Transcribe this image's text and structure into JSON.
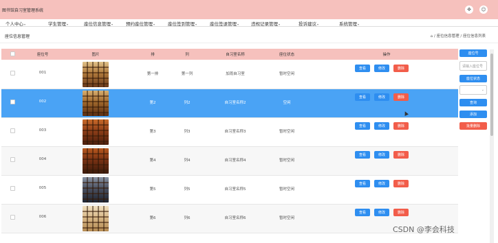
{
  "app": {
    "title": "图书馆自习室管理系统"
  },
  "nav": {
    "items": [
      {
        "label": "个人中心",
        "caret": "▾"
      },
      {
        "label": "学生管理",
        "caret": "▾"
      },
      {
        "label": "座位信息管理",
        "caret": "▾"
      },
      {
        "label": "预约座位管理",
        "caret": "▾"
      },
      {
        "label": "座位签到管理",
        "caret": "▾"
      },
      {
        "label": "座位签退管理",
        "caret": "▾"
      },
      {
        "label": "违规记录管理",
        "caret": "▾"
      },
      {
        "label": "投诉建议",
        "caret": "▾"
      },
      {
        "label": "系统管理",
        "caret": "▾"
      }
    ]
  },
  "page": {
    "title": "座位信息管理",
    "breadcrumb": "⌂ / 座位信息管理 / 座位信息列表"
  },
  "table": {
    "headers": [
      "座位号",
      "图片",
      "排",
      "列",
      "自习室名称",
      "座位状态",
      "操作"
    ],
    "rows": [
      {
        "seat": "001",
        "row": "第一排",
        "col": "第一列",
        "room": "加雨自习室",
        "status": "暂时空闲",
        "selected": false
      },
      {
        "seat": "002",
        "row": "第2",
        "col": "列2",
        "room": "自习室名称2",
        "status": "空闲",
        "selected": true
      },
      {
        "seat": "003",
        "row": "第3",
        "col": "列3",
        "room": "自习室名称3",
        "status": "暂时空闲",
        "selected": false
      },
      {
        "seat": "004",
        "row": "第4",
        "col": "列4",
        "room": "自习室名称4",
        "status": "暂时空闲",
        "selected": false
      },
      {
        "seat": "005",
        "row": "第5",
        "col": "列5",
        "room": "自习室名称5",
        "status": "暂时空闲",
        "selected": false
      },
      {
        "seat": "006",
        "row": "第6",
        "col": "列6",
        "room": "自习室名称6",
        "status": "暂时空闲",
        "selected": false
      }
    ],
    "actions": {
      "view": "查看",
      "edit": "修改",
      "delete": "删除"
    }
  },
  "sidebar": {
    "seat_button": "座位号",
    "seat_placeholder": "请输入座位号",
    "status_button": "座位状态",
    "search_button": "查询",
    "add_button": "添加",
    "batch_delete_button": "批量删除"
  },
  "colors": {
    "accent": "#2e8ef0",
    "header": "#f6c1bd",
    "selected": "#4aa3f5",
    "danger": "#f25d4a"
  },
  "watermark": "CSDN @李会科技"
}
